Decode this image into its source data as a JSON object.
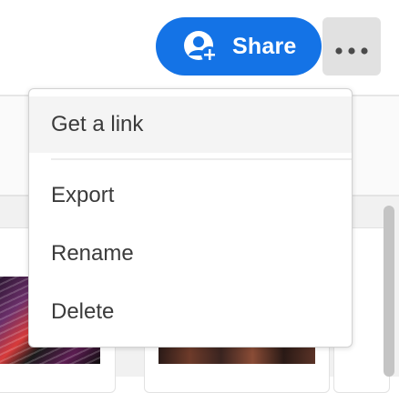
{
  "toolbar": {
    "share_label": "Share",
    "share_icon": "add-user-icon",
    "more_icon": "more-horizontal-icon"
  },
  "menu": {
    "items": [
      {
        "label": "Get a link",
        "highlighted": true
      },
      {
        "label": "Export",
        "highlighted": false
      },
      {
        "label": "Rename",
        "highlighted": false
      },
      {
        "label": "Delete",
        "highlighted": false
      }
    ]
  },
  "colors": {
    "accent": "#1473e6",
    "menu_text": "#3b3b3b",
    "more_button_bg": "#e1e1e1",
    "highlight_bg": "#f4f4f4"
  }
}
